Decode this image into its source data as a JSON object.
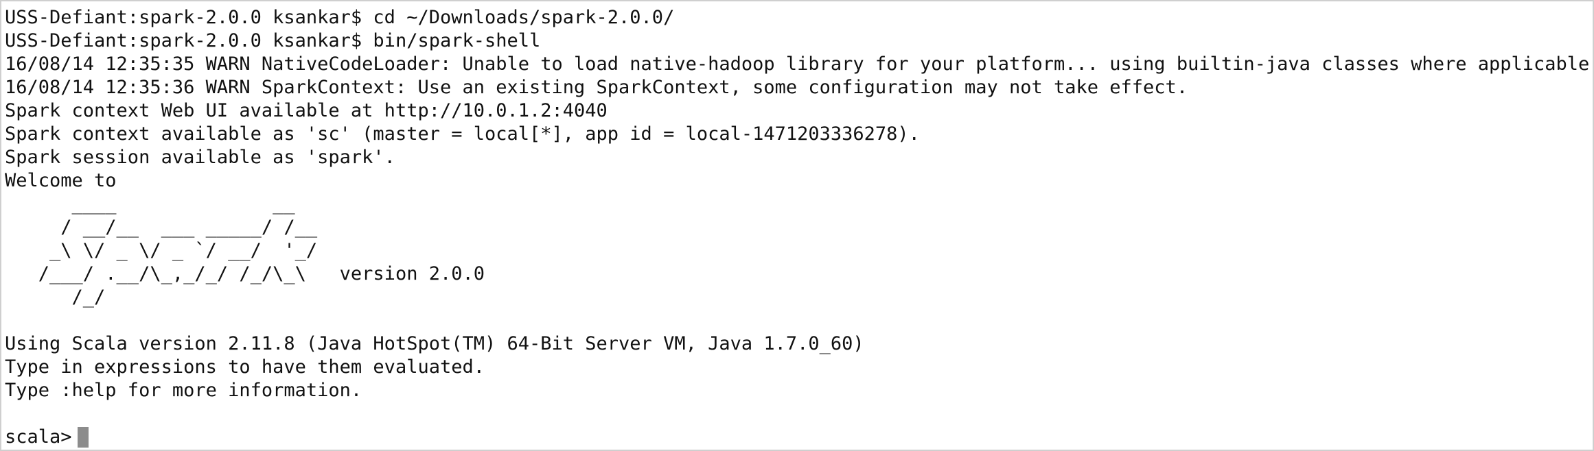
{
  "terminal": {
    "lines": [
      "USS-Defiant:spark-2.0.0 ksankar$ cd ~/Downloads/spark-2.0.0/",
      "USS-Defiant:spark-2.0.0 ksankar$ bin/spark-shell",
      "16/08/14 12:35:35 WARN NativeCodeLoader: Unable to load native-hadoop library for your platform... using builtin-java classes where applicable",
      "16/08/14 12:35:36 WARN SparkContext: Use an existing SparkContext, some configuration may not take effect.",
      "Spark context Web UI available at http://10.0.1.2:4040",
      "Spark context available as 'sc' (master = local[*], app id = local-1471203336278).",
      "Spark session available as 'spark'.",
      "Welcome to",
      "      ____              __",
      "     / __/__  ___ _____/ /__",
      "    _\\ \\/ _ \\/ _ `/ __/  '_/",
      "   /___/ .__/\\_,_/_/ /_/\\_\\   version 2.0.0",
      "      /_/",
      "",
      "Using Scala version 2.11.8 (Java HotSpot(TM) 64-Bit Server VM, Java 1.7.0_60)",
      "Type in expressions to have them evaluated.",
      "Type :help for more information.",
      "",
      "scala>"
    ]
  },
  "colors": {
    "background": "#ffffff",
    "text": "#111111",
    "cursor": "#8c8c8c",
    "border": "#cfcfcf"
  }
}
